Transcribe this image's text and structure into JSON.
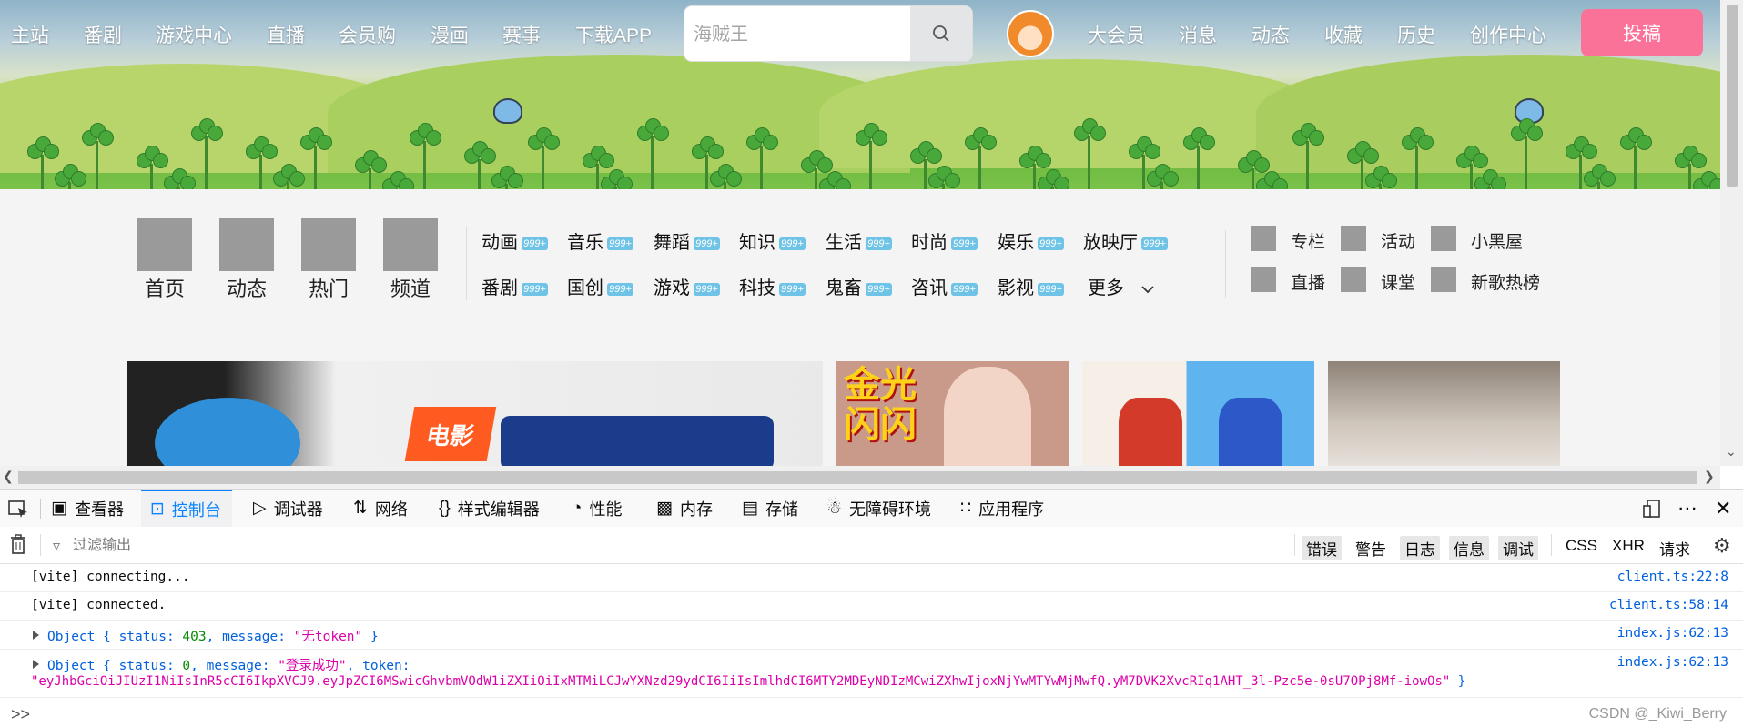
{
  "nav": {
    "left_items": [
      "主站",
      "番剧",
      "游戏中心",
      "直播",
      "会员购",
      "漫画",
      "赛事",
      "下载APP"
    ],
    "search_placeholder": "海贼王",
    "right_items": [
      "大会员",
      "消息",
      "动态",
      "收藏",
      "历史",
      "创作中心"
    ],
    "post_label": "投稿"
  },
  "main_entries": [
    "首页",
    "动态",
    "热门",
    "频道"
  ],
  "channels": {
    "row1": [
      "动画",
      "音乐",
      "舞蹈",
      "知识",
      "生活",
      "时尚",
      "娱乐",
      "放映厅"
    ],
    "row2": [
      "番剧",
      "国创",
      "游戏",
      "科技",
      "鬼畜",
      "咨讯",
      "影视"
    ],
    "badge": "999+",
    "more_label": "更多"
  },
  "side_links": {
    "row1": [
      "专栏",
      "活动",
      "小黑屋"
    ],
    "row2": [
      "直播",
      "课堂",
      "新歌热榜"
    ]
  },
  "cards": {
    "card1_text": "电影",
    "card2_text": "金光闪闪"
  },
  "devtools": {
    "tabs": [
      "查看器",
      "控制台",
      "调试器",
      "网络",
      "样式编辑器",
      "性能",
      "内存",
      "存储",
      "无障碍环境",
      "应用程序"
    ],
    "active_tab": "控制台",
    "filter_placeholder": "过滤输出",
    "levels": [
      "错误",
      "警告",
      "日志",
      "信息",
      "调试"
    ],
    "types": [
      "CSS",
      "XHR",
      "请求"
    ],
    "logs": [
      {
        "text": "[vite] connecting...",
        "source": "client.ts:22:8"
      },
      {
        "text": "[vite] connected.",
        "source": "client.ts:58:14"
      },
      {
        "obj": "Object { ",
        "k1": "status: ",
        "v1": "403",
        "k2": ", message: ",
        "v2": "\"无token\"",
        "end": " }",
        "source": "index.js:62:13"
      },
      {
        "obj": "Object { ",
        "k1": "status: ",
        "v1": "0",
        "k2": ", message: ",
        "v2": "\"登录成功\"",
        "k3": ", token:",
        "token": "\"eyJhbGciOiJIUzI1NiIsInR5cCI6IkpXVCJ9.eyJpZCI6MSwicGhvbmVOdW1iZXIiOiIxMTMiLCJwYXNzd29ydCI6IiIsImlhdCI6MTY2MDEyNDIzMCwiZXhwIjoxNjYwMTYwMjMwfQ.yM7DVK2XvcRIq1AHT_3l-Pzc5e-0sU7OPj8Mf-iowOs\"",
        "end": " }",
        "source": "index.js:62:13"
      }
    ],
    "prompt": ">>"
  },
  "watermark": "CSDN @_Kiwi_Berry",
  "colors": {
    "accent": "#fb7299",
    "devtools_blue": "#0a84ff",
    "badge": "#6fc3e6"
  }
}
